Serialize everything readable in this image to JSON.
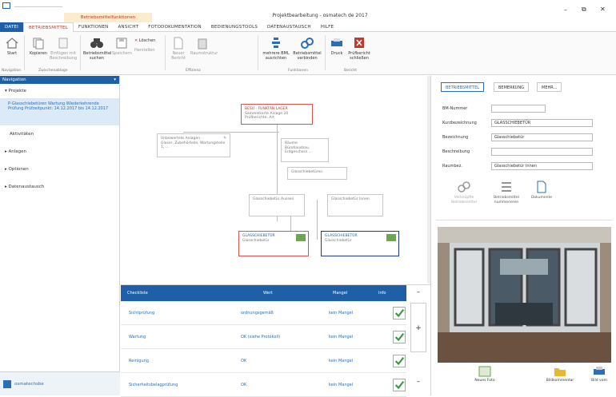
{
  "window": {
    "context_tab": "Betriebsmittelfunktionen",
    "title": "Projektbearbeitung - osmatech de 2017",
    "min": "–",
    "max": "⧉",
    "close": "✕"
  },
  "tabs": [
    "DATEI",
    "BETRIEBSMITTEL",
    "FUNKTIONEN",
    "ANSICHT",
    "FOTODOKUMENTATION",
    "BEDIENUNGSTOOLS",
    "DATENAUSTAUSCH",
    "HILFE"
  ],
  "ribbon": {
    "buttons": {
      "start": "Start",
      "kopieren": "Kopieren",
      "einfuegen": "Einfügen mit Beschreibung",
      "suchen": "Betriebsmittel suchen",
      "speichern": "Speichern",
      "loeschen": "Löschen",
      "herstellen": "Herstellen",
      "neuer_bericht": "Neuer Bericht",
      "raumstruktur": "Raumstruktur",
      "ausrichten": "mehrere BML ausrichten",
      "verbinden": "Betriebsmittel verbinden",
      "druck": "Druck",
      "pruefbericht": "Prüfbericht schließen"
    },
    "groups": [
      "Navigation",
      "Zwischenablage",
      "Effizienz",
      "Funktionen",
      "Bericht"
    ]
  },
  "nav": {
    "header": "Navigation",
    "pin": "▾",
    "projekte": "Projekte",
    "selected": "P-Glasschiebetüren Wartung Wiederkehrende Prüfung Prüfzeitpunkt: 14.12.2017 bis 14.12.2017",
    "items": [
      "Aktivitäten",
      "Anlagen",
      "Optionen",
      "Datenaustausch"
    ],
    "footer": "osmatechsbe"
  },
  "canvas": {
    "nodes": {
      "root_title": "BESU - FUNKTAN LAGER",
      "root_sub": "Sammelkarte Anlage 20 Prüfberichte, Art",
      "left_title": "Unbewertete Anlagen",
      "left_sub": "Glaser, Zubehörteile, Wartungsteile 1, ...",
      "mid_title": "Räume",
      "mid_sub": "Bürohausbau, Erdgeschoss ...",
      "child_a": "Glasschiebetüren",
      "child_b": "Glasschiebetür Aussen",
      "child_c": "Glasschiebetür Innen",
      "leaf_left_title": "GLASSCHIEBETÜR",
      "leaf_left_sub": "Glasschiebetür",
      "leaf_right_title": "GLASSCHIEBETÜR",
      "leaf_right_sub": "Glasschiebetür"
    }
  },
  "checklist": {
    "headers": [
      "Checkliste",
      "Wert",
      "Mangel",
      "Info"
    ],
    "rows": [
      {
        "name": "Sichtprüfung",
        "wert": "ordnungsgemäß",
        "mangel": "kein Mangel"
      },
      {
        "name": "Wartung",
        "wert": "OK (siehe Protokoll)",
        "mangel": "kein Mangel"
      },
      {
        "name": "Reinigung",
        "wert": "OK",
        "mangel": "kein Mangel"
      },
      {
        "name": "Sicherheitsbelagprüfung",
        "wert": "OK",
        "mangel": "kein Mangel"
      }
    ],
    "scroll_up": "–",
    "scroll_add": "+",
    "scroll_down": "–"
  },
  "side": {
    "tabs": [
      "BETRIEBSMITTEL",
      "BEMERKUNG",
      "MEHR..."
    ],
    "fields": [
      {
        "label": "BM-Nummer",
        "value": ""
      },
      {
        "label": "Kurzbezeichnung",
        "value": "GLASSCHIEBETÜR"
      },
      {
        "label": "Bezeichnung",
        "value": "Glasschiebetür"
      },
      {
        "label": "Beschreibung",
        "value": ""
      },
      {
        "label": "Raumbez.",
        "value": "Glasschiebetür Innen"
      }
    ],
    "actions": [
      "Verknüpfte Betriebsmittel",
      "Betriebsmittel nummerieren",
      "Dokumente"
    ],
    "bottom": [
      "Neues Foto",
      "Bildkommentar",
      "Bild vom"
    ]
  },
  "colors": {
    "brand": "#1f5fa8",
    "accent_red": "#c0392b",
    "check_green": "#3a9a3a"
  }
}
